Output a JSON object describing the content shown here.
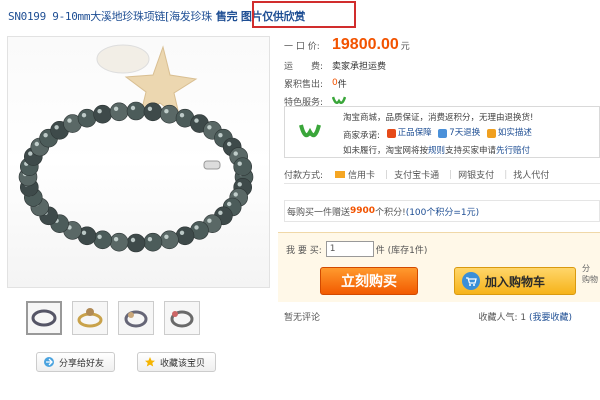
{
  "title": {
    "code": "SN0199 9-10mm",
    "name": "大溪地珍珠项链[海发珍珠",
    "notice": "售完 图片仅供欣赏"
  },
  "product": {
    "price_label": "一 口 价:",
    "price": "19800.00",
    "price_unit": "元",
    "shipping_label": "运　　费:",
    "shipping_value": "卖家承担运费",
    "sales_label": "累积售出:",
    "sales_value": "0",
    "sales_unit": "件",
    "service_label": "特色服务:"
  },
  "guarantee": {
    "line1": "淘宝商城，品质保证，消费返积分，无理由退换货!",
    "merchant_label": "商家承诺:",
    "tags": [
      "正品保障",
      "7天退换",
      "如实描述"
    ],
    "line3_prefix": "如未履行，淘宝网将按",
    "line3_link": "规则",
    "line3_mid": "支持买家申请",
    "line3_link2": "先行赔付"
  },
  "payment": {
    "label": "付款方式:",
    "methods": [
      "信用卡",
      "支付宝卡通",
      "网银支付",
      "找人代付"
    ]
  },
  "points": {
    "prefix": "每购买一件赠送",
    "number": "9900",
    "suffix": "个积分!",
    "note": "(100个积分=1元)"
  },
  "buy": {
    "qty_label": "我 要 买:",
    "qty_value": "1",
    "stock_text": "件 (库存1件)",
    "buy_now": "立刻购买",
    "add_cart": "加入购物车",
    "tail": "分\n购物"
  },
  "bottom": {
    "reviews": "暂无评论",
    "popularity_label": "收藏人气:",
    "popularity_value": "1",
    "favorite_link": "(我要收藏)"
  },
  "share": {
    "share_label": "分享给好友",
    "collect_label": "收藏该宝贝"
  },
  "colors": {
    "accent_orange": "#f25300",
    "link_blue": "#1f4f94",
    "highlight_red": "#d12d2d"
  }
}
